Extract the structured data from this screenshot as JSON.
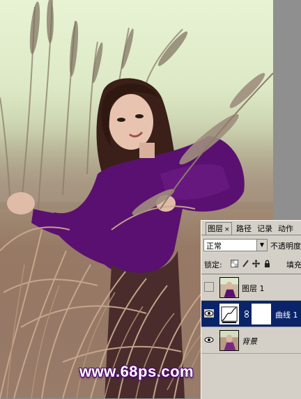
{
  "watermark": "www.68ps.com",
  "colors": {
    "panel_bg": "#d4d0c8",
    "selection": "#0a246a",
    "sky": "#e7f3d3",
    "shirt_purple": "#5a1070",
    "watermark_outline": "#4a0a6e"
  },
  "layers_panel": {
    "tabs": [
      {
        "label": "图层",
        "close": "×"
      },
      {
        "label": "路径"
      },
      {
        "label": "记录"
      },
      {
        "label": "动作"
      }
    ],
    "blend_mode": "正常",
    "opacity_label": "不透明度",
    "lock_label": "锁定:",
    "lock_icons": [
      "lock-transparency-icon",
      "lock-brush-icon",
      "lock-move-icon",
      "lock-all-icon"
    ],
    "fill_label": "填充",
    "layers": [
      {
        "name": "图层 1",
        "visible": false,
        "selected": false
      },
      {
        "name": "曲线 1",
        "visible": true,
        "selected": true
      },
      {
        "name": "背景",
        "visible": true,
        "selected": false
      }
    ]
  }
}
